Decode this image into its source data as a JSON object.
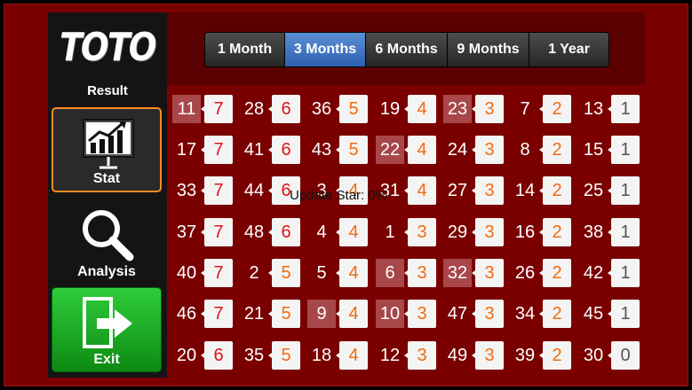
{
  "sidebar": {
    "logo": "TOTO",
    "logo_sub": "Result",
    "stat_label": "Stat",
    "analysis_label": "Analysis",
    "exit_label": "Exit"
  },
  "tabs": [
    {
      "label": "1 Month",
      "active": false
    },
    {
      "label": "3 Months",
      "active": true
    },
    {
      "label": "6 Months",
      "active": false
    },
    {
      "label": "9 Months",
      "active": false
    },
    {
      "label": "1 Year",
      "active": false
    }
  ],
  "overlay_text": "Update Star: 0%",
  "colors": {
    "frame": "#7a0000",
    "highlight": "#a8474a",
    "count_red": "#e0141a",
    "count_orange": "#f26a10",
    "active_tab": "#3a6fc0"
  },
  "grid": [
    [
      {
        "n": "11",
        "c": "7",
        "hl": true
      },
      {
        "n": "28",
        "c": "6",
        "hl": false
      },
      {
        "n": "36",
        "c": "5",
        "hl": false
      },
      {
        "n": "19",
        "c": "4",
        "hl": false
      },
      {
        "n": "23",
        "c": "3",
        "hl": true
      },
      {
        "n": "7",
        "c": "2",
        "hl": false
      },
      {
        "n": "13",
        "c": "1",
        "hl": false
      }
    ],
    [
      {
        "n": "17",
        "c": "7",
        "hl": false
      },
      {
        "n": "41",
        "c": "6",
        "hl": false
      },
      {
        "n": "43",
        "c": "5",
        "hl": false
      },
      {
        "n": "22",
        "c": "4",
        "hl": true
      },
      {
        "n": "24",
        "c": "3",
        "hl": false
      },
      {
        "n": "8",
        "c": "2",
        "hl": false
      },
      {
        "n": "15",
        "c": "1",
        "hl": false
      }
    ],
    [
      {
        "n": "33",
        "c": "7",
        "hl": false
      },
      {
        "n": "44",
        "c": "6",
        "hl": false
      },
      {
        "n": "3",
        "c": "4",
        "hl": false
      },
      {
        "n": "31",
        "c": "4",
        "hl": false
      },
      {
        "n": "27",
        "c": "3",
        "hl": false
      },
      {
        "n": "14",
        "c": "2",
        "hl": false
      },
      {
        "n": "25",
        "c": "1",
        "hl": false
      }
    ],
    [
      {
        "n": "37",
        "c": "7",
        "hl": false
      },
      {
        "n": "48",
        "c": "6",
        "hl": false
      },
      {
        "n": "4",
        "c": "4",
        "hl": false
      },
      {
        "n": "1",
        "c": "3",
        "hl": false
      },
      {
        "n": "29",
        "c": "3",
        "hl": false
      },
      {
        "n": "16",
        "c": "2",
        "hl": false
      },
      {
        "n": "38",
        "c": "1",
        "hl": false
      }
    ],
    [
      {
        "n": "40",
        "c": "7",
        "hl": false
      },
      {
        "n": "2",
        "c": "5",
        "hl": false
      },
      {
        "n": "5",
        "c": "4",
        "hl": false
      },
      {
        "n": "6",
        "c": "3",
        "hl": true
      },
      {
        "n": "32",
        "c": "3",
        "hl": true
      },
      {
        "n": "26",
        "c": "2",
        "hl": false
      },
      {
        "n": "42",
        "c": "1",
        "hl": false
      }
    ],
    [
      {
        "n": "46",
        "c": "7",
        "hl": false
      },
      {
        "n": "21",
        "c": "5",
        "hl": false
      },
      {
        "n": "9",
        "c": "4",
        "hl": true
      },
      {
        "n": "10",
        "c": "3",
        "hl": true
      },
      {
        "n": "47",
        "c": "3",
        "hl": false
      },
      {
        "n": "34",
        "c": "2",
        "hl": false
      },
      {
        "n": "45",
        "c": "1",
        "hl": false
      }
    ],
    [
      {
        "n": "20",
        "c": "6",
        "hl": false
      },
      {
        "n": "35",
        "c": "5",
        "hl": false
      },
      {
        "n": "18",
        "c": "4",
        "hl": false
      },
      {
        "n": "12",
        "c": "3",
        "hl": false
      },
      {
        "n": "49",
        "c": "3",
        "hl": false
      },
      {
        "n": "39",
        "c": "2",
        "hl": false
      },
      {
        "n": "30",
        "c": "0",
        "hl": false
      }
    ]
  ]
}
